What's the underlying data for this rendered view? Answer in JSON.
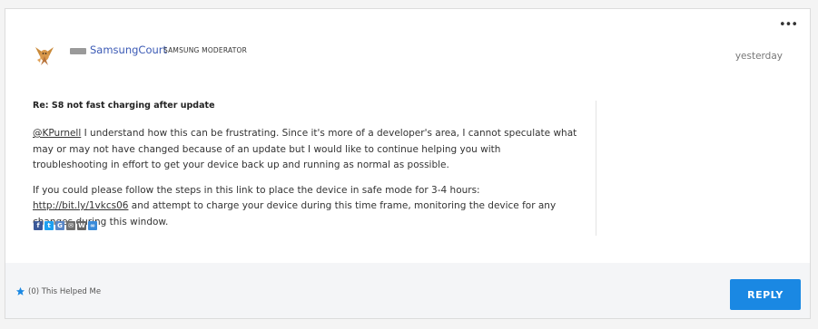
{
  "post": {
    "author": "SamsungCourt",
    "role": "SAMSUNG MODERATOR",
    "date": "yesterday",
    "more": "•••",
    "subject": "Re: S8 not fast charging after update",
    "para1_mention": "@KPurnell",
    "para1_text": " I understand how this can be frustrating. Since it's more of a developer's area, I cannot speculate what may or may not have changed because of an update but I would like to continue helping you with troubleshooting in effort to get your device back up and running as normal as possible.",
    "para2_before": "If you could please follow the steps in this link to place the device in safe mode for 3-4 hours: ",
    "para2_link": "http://bit.ly/1vkcs06",
    "para2_after": " and attempt to charge your device during this time frame, monitoring the device for any changes during this window."
  },
  "share_icons": [
    {
      "name": "facebook-icon",
      "glyph": "f",
      "color": "#3b5998"
    },
    {
      "name": "twitter-icon",
      "glyph": "t",
      "color": "#1da1f2"
    },
    {
      "name": "google-icon",
      "glyph": "G",
      "color": "#5a87c6"
    },
    {
      "name": "email-icon",
      "glyph": "✉",
      "color": "#6f6f6f"
    },
    {
      "name": "wordpress-icon",
      "glyph": "W",
      "color": "#666666"
    },
    {
      "name": "link-icon",
      "glyph": "∞",
      "color": "#3a8bd9"
    }
  ],
  "footer": {
    "kudos_label": "(0) This Helped Me",
    "reply_label": "REPLY"
  },
  "colors": {
    "accent": "#1a88e3",
    "username": "#3b5ab5"
  }
}
